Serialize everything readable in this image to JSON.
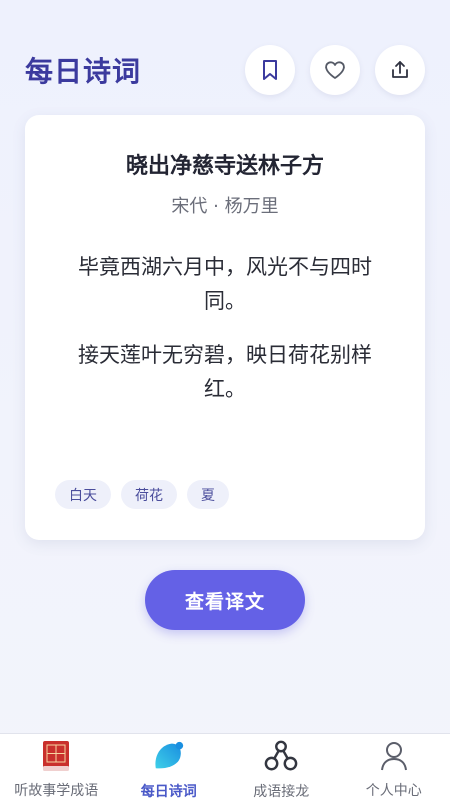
{
  "header": {
    "title": "每日诗词",
    "buttons": [
      {
        "icon": "bookmark-icon"
      },
      {
        "icon": "heart-icon"
      },
      {
        "icon": "share-icon"
      }
    ]
  },
  "poem": {
    "title": "晓出净慈寺送林子方",
    "author": "宋代 · 杨万里",
    "lines": [
      "毕竟西湖六月中，风光不与四时同。",
      "接天莲叶无穷碧，映日荷花别样红。"
    ],
    "tags": [
      "白天",
      "荷花",
      "夏"
    ]
  },
  "actions": {
    "translate_label": "查看译文"
  },
  "tabbar": {
    "tabs": [
      {
        "label": "听故事学成语",
        "icon": "dictionary-book-icon",
        "active": false
      },
      {
        "label": "每日诗词",
        "icon": "leaf-bubble-icon",
        "active": true
      },
      {
        "label": "成语接龙",
        "icon": "chain-nodes-icon",
        "active": false
      },
      {
        "label": "个人中心",
        "icon": "user-icon",
        "active": false
      }
    ]
  },
  "colors": {
    "accent": "#6461e6",
    "title": "#3b3a9e",
    "active_tab": "#4a59c8"
  }
}
